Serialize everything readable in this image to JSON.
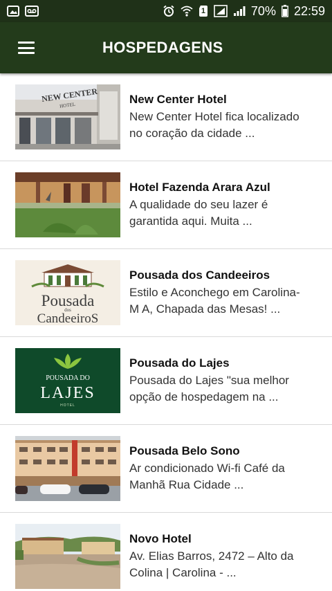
{
  "status_bar": {
    "battery_percent": "70%",
    "time": "22:59",
    "sim_label": "1"
  },
  "app_bar": {
    "title": "HOSPEDAGENS"
  },
  "hotels": [
    {
      "name": "New Center Hotel",
      "desc_line1": "New Center Hotel fica localizado",
      "desc_line2": "no coração da cidade ..."
    },
    {
      "name": "Hotel Fazenda Arara Azul",
      "desc_line1": "A qualidade do seu lazer é",
      "desc_line2": "garantida aqui. Muita ..."
    },
    {
      "name": "Pousada dos Candeeiros",
      "desc_line1": "Estilo e Aconchego em Carolina-",
      "desc_line2": "M A, Chapada das Mesas! ..."
    },
    {
      "name": "Pousada do Lajes",
      "desc_line1": "Pousada do Lajes \"sua melhor",
      "desc_line2": "opção de hospedagem na ..."
    },
    {
      "name": "Pousada Belo Sono",
      "desc_line1": "Ar condicionado Wi-fi Café da",
      "desc_line2": "Manhã Rua Cidade ..."
    },
    {
      "name": "Novo Hotel",
      "desc_line1": "Av. Elias Barros, 2472 – Alto da",
      "desc_line2": "Colina | Carolina - ..."
    }
  ],
  "logos": {
    "new_center_sign_line1": "NEW CENTER",
    "new_center_sign_line2": "HOTEL",
    "candeeiros_word1": "Pousada",
    "candeeiros_word2": "dos",
    "candeeiros_word3": "CandeeiroS",
    "lajes_word1": "POUSADA DO",
    "lajes_word2": "LAJES",
    "lajes_word3": "HOTEL"
  },
  "colors": {
    "status_bar": "#1f3118",
    "app_bar": "#233b1b",
    "divider": "#d9d9d9"
  }
}
